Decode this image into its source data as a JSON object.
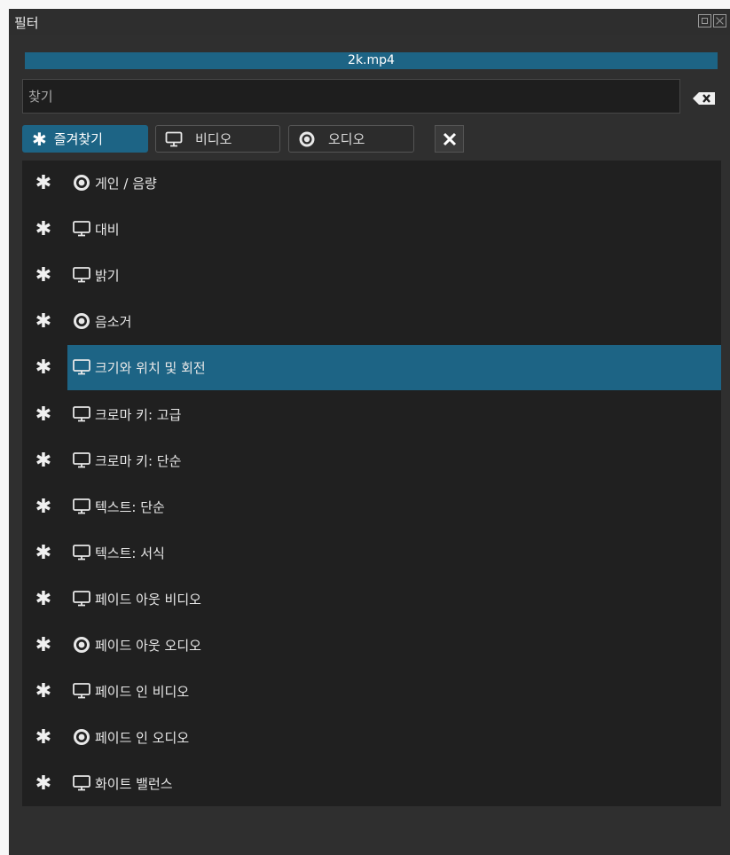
{
  "panel": {
    "title": "필터"
  },
  "clip": {
    "name": "2k.mp4"
  },
  "search": {
    "placeholder": "찾기",
    "value": ""
  },
  "tabs": [
    {
      "label": "즐겨찾기",
      "icon": "asterisk-icon",
      "active": true
    },
    {
      "label": "비디오",
      "icon": "monitor-icon",
      "active": false
    },
    {
      "label": "오디오",
      "icon": "speaker-icon",
      "active": false
    }
  ],
  "filters": [
    {
      "label": "게인 / 음량",
      "type": "audio"
    },
    {
      "label": "대비",
      "type": "video"
    },
    {
      "label": "밝기",
      "type": "video"
    },
    {
      "label": "음소거",
      "type": "audio"
    },
    {
      "label": "크기와 위치 및 회전",
      "type": "video",
      "selected": true
    },
    {
      "label": "크로마 키: 고급",
      "type": "video"
    },
    {
      "label": "크로마 키: 단순",
      "type": "video"
    },
    {
      "label": "텍스트: 단순",
      "type": "video"
    },
    {
      "label": "텍스트: 서식",
      "type": "video"
    },
    {
      "label": "페이드 아웃 비디오",
      "type": "video"
    },
    {
      "label": "페이드 아웃 오디오",
      "type": "audio"
    },
    {
      "label": "페이드 인 비디오",
      "type": "video"
    },
    {
      "label": "페이드 인 오디오",
      "type": "audio"
    },
    {
      "label": "화이트 밸런스",
      "type": "video"
    }
  ],
  "colors": {
    "accent": "#1d6485",
    "list_bg": "#202020",
    "panel_bg": "#2f2f2f"
  }
}
